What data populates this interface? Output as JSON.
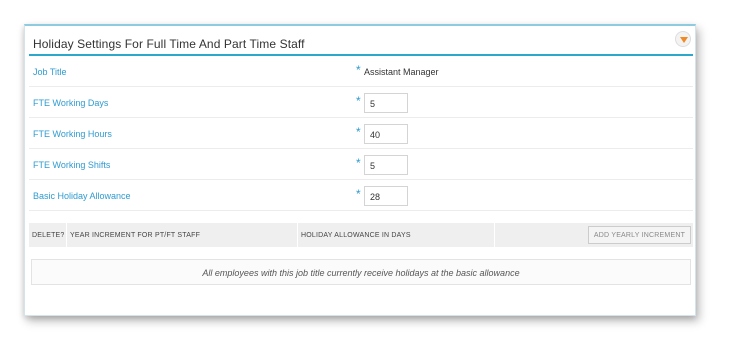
{
  "panel": {
    "title": "Holiday Settings For Full Time And Part Time Staff",
    "toggle_icon": "chevron-down-icon"
  },
  "fields": [
    {
      "label": "Job Title",
      "required": "*",
      "value": "Assistant Manager",
      "type": "text"
    },
    {
      "label": "FTE Working Days",
      "required": "*",
      "value": "5",
      "type": "input"
    },
    {
      "label": "FTE Working Hours",
      "required": "*",
      "value": "40",
      "type": "input"
    },
    {
      "label": "FTE Working Shifts",
      "required": "*",
      "value": "5",
      "type": "input"
    },
    {
      "label": "Basic Holiday Allowance",
      "required": "*",
      "value": "28",
      "type": "input"
    }
  ],
  "table": {
    "columns": [
      "DELETE?",
      "YEAR INCREMENT FOR PT/FT STAFF",
      "HOLIDAY ALLOWANCE IN DAYS"
    ],
    "add_button": "ADD YEARLY INCREMENT"
  },
  "message": "All employees with this job title currently receive holidays at the basic allowance",
  "colors": {
    "accent": "#2f9bd0",
    "header_rule": "#2fa6cc",
    "toggle_arrow": "#f08a24"
  }
}
